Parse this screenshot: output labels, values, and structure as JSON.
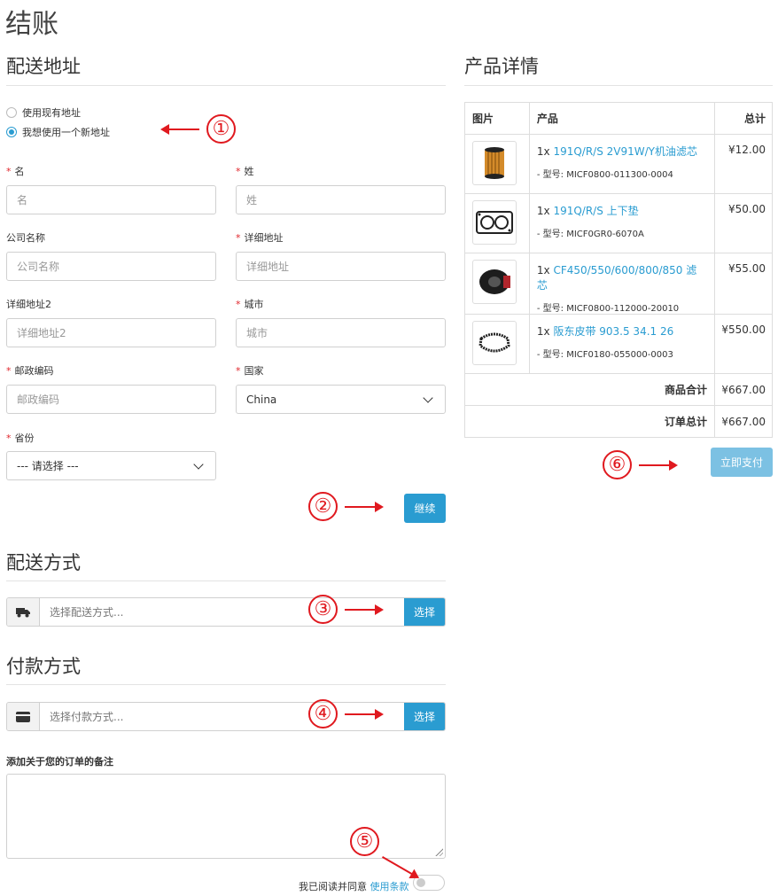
{
  "page": {
    "title": "结账"
  },
  "shipping_address": {
    "title": "配送地址",
    "option_existing": "使用现有地址",
    "option_new": "我想使用一个新地址",
    "required_mark": "*",
    "fields": {
      "firstname": {
        "label": "名",
        "placeholder": "名"
      },
      "lastname": {
        "label": "姓",
        "placeholder": "姓"
      },
      "company": {
        "label": "公司名称",
        "placeholder": "公司名称"
      },
      "address1": {
        "label": "详细地址",
        "placeholder": "详细地址"
      },
      "address2": {
        "label": "详细地址2",
        "placeholder": "详细地址2"
      },
      "city": {
        "label": "城市",
        "placeholder": "城市"
      },
      "postcode": {
        "label": "邮政编码",
        "placeholder": "邮政编码"
      },
      "country": {
        "label": "国家",
        "value": "China"
      },
      "zone": {
        "label": "省份",
        "value": "--- 请选择 ---"
      }
    },
    "continue_label": "继续"
  },
  "shipping_method": {
    "title": "配送方式",
    "placeholder": "选择配送方式...",
    "button": "选择",
    "icon": "truck-icon"
  },
  "payment_method": {
    "title": "付款方式",
    "placeholder": "选择付款方式...",
    "button": "选择",
    "icon": "credit-card-icon"
  },
  "comment": {
    "label": "添加关于您的订单的备注"
  },
  "terms": {
    "text": "我已阅读并同意",
    "link": "使用条款",
    "checked": false
  },
  "product_details": {
    "title": "产品详情",
    "columns": [
      "图片",
      "产品",
      "总计"
    ],
    "items": [
      {
        "qty": "1x",
        "name": "191Q/R/S 2V91W/Y机油滤芯",
        "model": "- 型号: MICF0800-011300-0004",
        "total": "¥12.00",
        "image": "oil-filter"
      },
      {
        "qty": "1x",
        "name": "191Q/R/S 上下垫",
        "model": "- 型号: MICF0GR0-6070A",
        "total": "¥50.00",
        "image": "gasket"
      },
      {
        "qty": "1x",
        "name": "CF450/550/600/800/850 滤芯",
        "model": "- 型号: MICF0800-112000-20010",
        "total": "¥55.00",
        "image": "air-filter"
      },
      {
        "qty": "1x",
        "name": "阪东皮带 903.5 34.1 26",
        "model": "- 型号: MICF0180-055000-0003",
        "total": "¥550.00",
        "image": "belt"
      }
    ],
    "subtotal_label": "商品合计",
    "subtotal": "¥667.00",
    "total_label": "订单总计",
    "total": "¥667.00",
    "pay_label": "立即支付"
  },
  "annotations": [
    "①",
    "②",
    "③",
    "④",
    "⑤",
    "⑥"
  ],
  "colors": {
    "accent": "#2a9cd1",
    "annotation": "#e0191f",
    "required": "#e0262c"
  }
}
